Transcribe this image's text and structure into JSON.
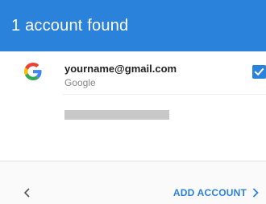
{
  "header": {
    "title": "1 account found",
    "color": "#2b82da"
  },
  "accounts": [
    {
      "email": "yourname@gmail.com",
      "provider": "Google",
      "icon": "google-g-icon",
      "checked": true
    }
  ],
  "footer": {
    "back_icon": "chevron-left-icon",
    "add_account_label": "ADD ACCOUNT",
    "forward_icon": "chevron-right-icon"
  }
}
